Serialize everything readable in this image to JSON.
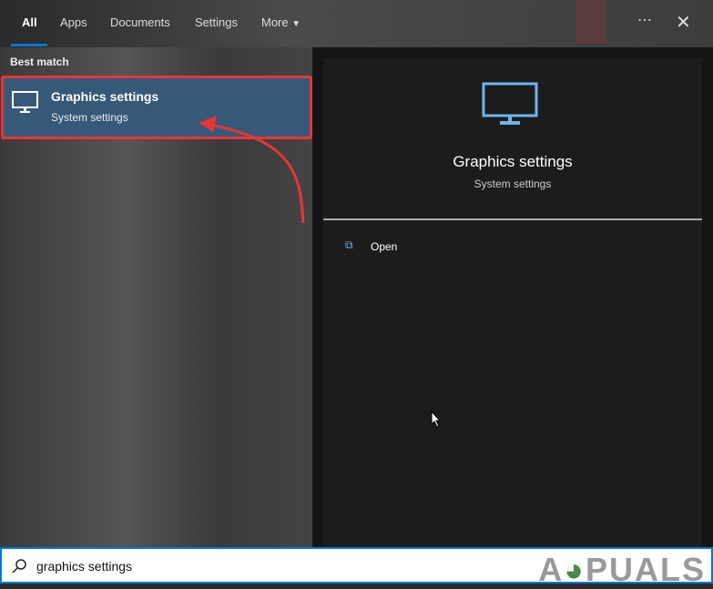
{
  "tabs": [
    "All",
    "Apps",
    "Documents",
    "Settings",
    "More"
  ],
  "section": "Best match",
  "result": {
    "title": "Graphics settings",
    "subtitle": "System settings"
  },
  "detail": {
    "title": "Graphics settings",
    "subtitle": "System settings",
    "action": "Open"
  },
  "search": {
    "value": "graphics settings"
  },
  "watermark": "APPUALS",
  "colors": {
    "accent": "#0078d7",
    "highlight": "#36597a",
    "annotation": "#e83535"
  }
}
